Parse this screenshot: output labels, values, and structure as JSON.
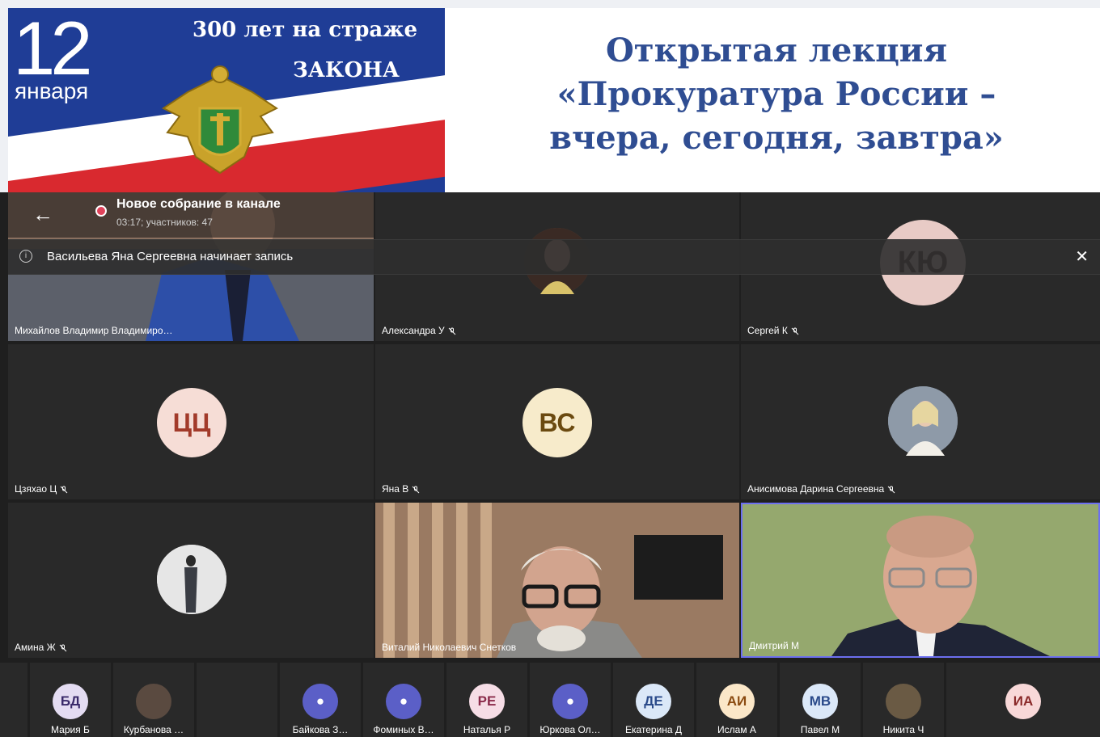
{
  "banner": {
    "date_day": "12",
    "date_month": "января",
    "slogan_line1": "300 лет на страже",
    "slogan_line2": "ЗАКОНА",
    "lecture_line1": "Открытая лекция",
    "lecture_line2": "«Прокуратура России –",
    "lecture_line3": "вчера, сегодня, завтра»",
    "colors": {
      "blue": "#1f3d96",
      "red": "#d9292f",
      "title": "#2f4d92"
    }
  },
  "meeting": {
    "title": "Новое собрание в канале",
    "subtitle": "03:17; участников: 47",
    "recording_notice": "Васильева Яна Сергеевна начинает запись",
    "participants": [
      {
        "name": "Михайлов Владимир Владимиро…",
        "muted": false
      },
      {
        "name": "Александра У",
        "muted": true
      },
      {
        "name": "Сергей К",
        "muted": true,
        "initials": "КЮ"
      },
      {
        "name": "Цзяхао Ц",
        "muted": true,
        "initials": "ЦЦ"
      },
      {
        "name": "Яна В",
        "muted": true,
        "initials": "ВС"
      },
      {
        "name": "Анисимова Дарина Сергеевна",
        "muted": true
      },
      {
        "name": "Амина Ж",
        "muted": true
      },
      {
        "name": "Виталий Николаевич Снетков",
        "muted": false
      },
      {
        "name": "Дмитрий М",
        "muted": false
      }
    ],
    "strip": [
      {
        "name": "Мария Б",
        "initials": "БД"
      },
      {
        "name": "Курбанова …",
        "initials": ""
      },
      {
        "name": "",
        "initials": ""
      },
      {
        "name": "Байкова З…",
        "initials": ""
      },
      {
        "name": "Фоминых В…",
        "initials": ""
      },
      {
        "name": "Наталья Р",
        "initials": "РЕ"
      },
      {
        "name": "Юркова Ол…",
        "initials": ""
      },
      {
        "name": "Екатерина Д",
        "initials": "ДЕ"
      },
      {
        "name": "Ислам А",
        "initials": "АИ"
      },
      {
        "name": "Павел М",
        "initials": "МВ"
      },
      {
        "name": "Никита Ч",
        "initials": ""
      },
      {
        "name": "",
        "initials": "ИА"
      }
    ]
  }
}
